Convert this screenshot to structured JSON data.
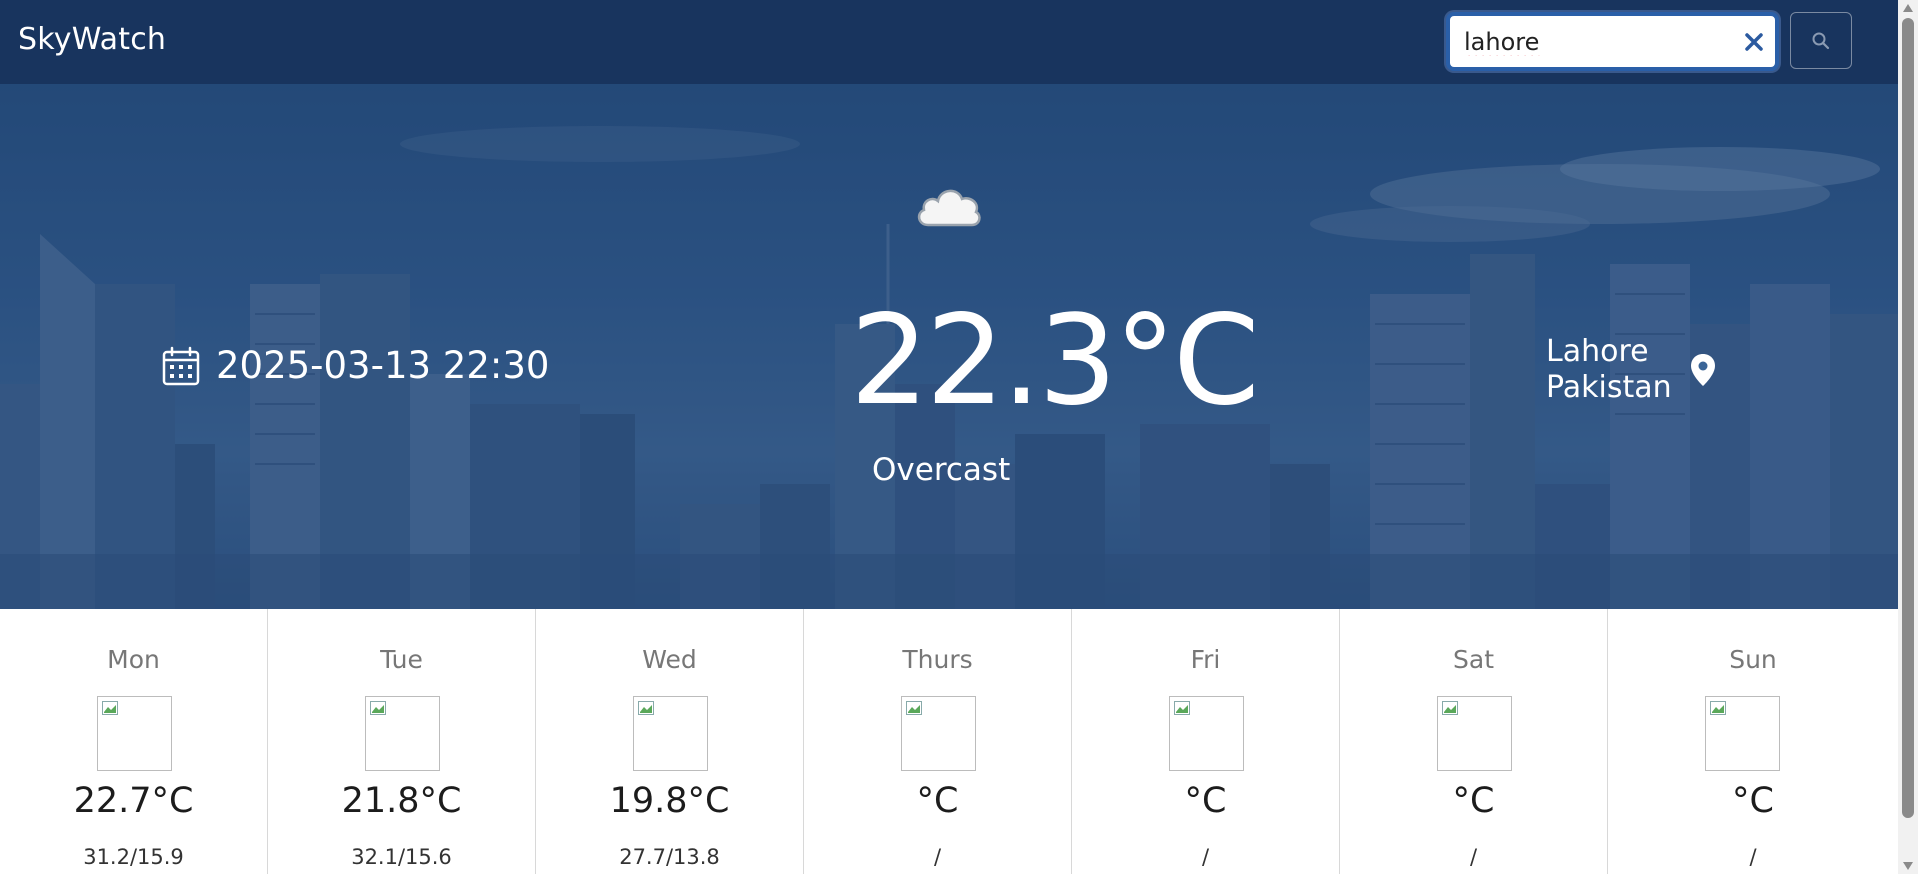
{
  "navbar": {
    "brand": "SkyWatch",
    "search": {
      "value": "lahore",
      "placeholder": ""
    }
  },
  "current": {
    "datetime": "2025-03-13 22:30",
    "temperature": "22.3°C",
    "condition": "Overcast",
    "city": "Lahore",
    "country": "Pakistan",
    "icon": "cloud-icon"
  },
  "forecast": [
    {
      "day": "Mon",
      "temp": "22.7°C",
      "range": "31.2/15.9"
    },
    {
      "day": "Tue",
      "temp": "21.8°C",
      "range": "32.1/15.6"
    },
    {
      "day": "Wed",
      "temp": "19.8°C",
      "range": "27.7/13.8"
    },
    {
      "day": "Thurs",
      "temp": "°C",
      "range": "/"
    },
    {
      "day": "Fri",
      "temp": "°C",
      "range": "/"
    },
    {
      "day": "Sat",
      "temp": "°C",
      "range": "/"
    },
    {
      "day": "Sun",
      "temp": "°C",
      "range": "/"
    }
  ],
  "colors": {
    "navbar_bg": "#18345e",
    "search_border": "#2a5fa8",
    "clear_icon": "#2b5aa0",
    "hero_overlay": "#18345e"
  },
  "icons": [
    "calendar-icon",
    "cloud-icon",
    "map-pin-icon",
    "search-icon",
    "close-icon",
    "broken-image-icon"
  ]
}
